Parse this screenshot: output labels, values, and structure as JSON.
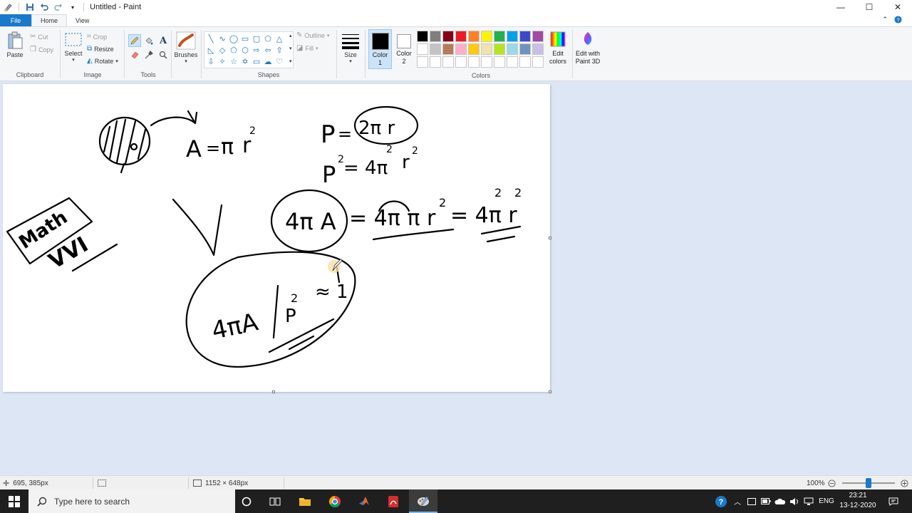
{
  "window": {
    "title": "Untitled - Paint",
    "minimize": "—",
    "maximize": "☐",
    "close": "✕"
  },
  "tabs": {
    "file": "File",
    "home": "Home",
    "view": "View"
  },
  "ribbon": {
    "clipboard": {
      "label": "Clipboard",
      "paste": "Paste",
      "cut": "Cut",
      "copy": "Copy"
    },
    "image": {
      "label": "Image",
      "select": "Select",
      "crop": "Crop",
      "resize": "Resize",
      "rotate": "Rotate"
    },
    "tools": {
      "label": "Tools"
    },
    "brushes": {
      "label": "Brushes"
    },
    "shapes": {
      "label": "Shapes",
      "outline": "Outline",
      "fill": "Fill"
    },
    "size": {
      "label": "Size"
    },
    "colors": {
      "label": "Colors",
      "color1": "Color\n1",
      "color2": "Color\n2",
      "color1_value": "#000000",
      "color2_value": "#ffffff",
      "edit_colors": "Edit\ncolors",
      "paint3d": "Edit with\nPaint 3D",
      "palette_row1": [
        "#000000",
        "#7f7f7f",
        "#880015",
        "#ed1c24",
        "#ff7f27",
        "#fff200",
        "#22b14c",
        "#00a2e8",
        "#3f48cc",
        "#a349a4"
      ],
      "palette_row2": [
        "#ffffff",
        "#c3c3c3",
        "#b97a57",
        "#ffaec9",
        "#ffc90e",
        "#efe4b0",
        "#b5e61d",
        "#99d9ea",
        "#7092be",
        "#c8bfe7"
      ],
      "palette_row3": [
        "#ffffff",
        "#ffffff",
        "#ffffff",
        "#ffffff",
        "#ffffff",
        "#ffffff",
        "#ffffff",
        "#ffffff",
        "#ffffff",
        "#ffffff"
      ]
    }
  },
  "canvas": {
    "drawing": {
      "eq_area_A": "A",
      "eq_area_eq": "=",
      "eq_area_pi": "π",
      "eq_area_r": "r",
      "eq_area_sup": "2",
      "eq_perim_P": "P",
      "eq_perim_eq": "=",
      "eq_perim_rhs": "2π r",
      "eq_psq_P": "P",
      "eq_psq_sup": "2",
      "eq_psq_rhs": "= 4π",
      "eq_psq_sup2": "2",
      "eq_psq_r": "r",
      "eq_psq_sup3": "2",
      "math_box": "Math",
      "vvi": "VVI",
      "eq_big_left": "4π A",
      "eq_big_mid": "= 4π π r",
      "eq_big_mid_sup": "2",
      "eq_big_right": "= 4π r",
      "eq_big_right_sup1": "2",
      "eq_big_right_sup2": "2",
      "eq_ratio": "4πA",
      "eq_ratio_P": "P",
      "eq_ratio_sup": "2",
      "eq_ratio_approx": "≈ 1"
    }
  },
  "status": {
    "cursor": "695, 385px",
    "size": "1152 × 648px",
    "zoom": "100%"
  },
  "taskbar": {
    "search_placeholder": "Type here to search",
    "lang": "ENG",
    "time": "23:21",
    "date": "13-12-2020"
  }
}
